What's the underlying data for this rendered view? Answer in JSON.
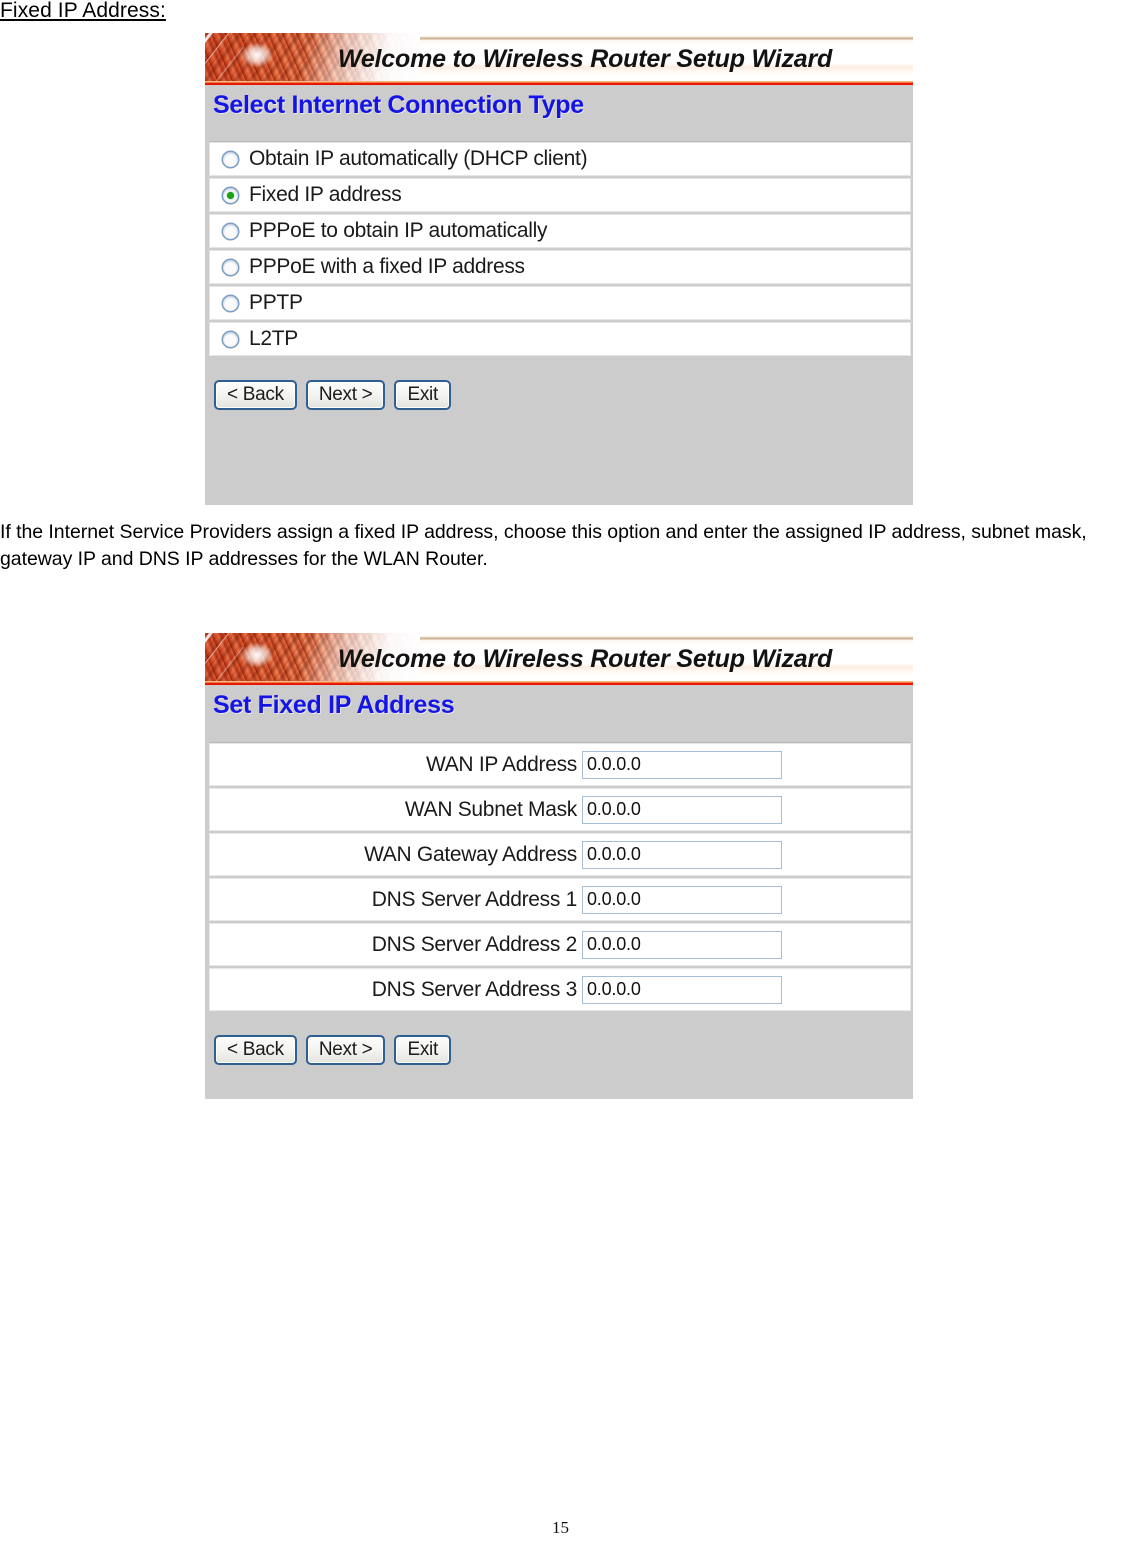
{
  "document": {
    "heading": "Fixed IP Address:",
    "paragraph": "If the Internet Service Providers assign a fixed IP address, choose this option and enter the assigned IP address, subnet mask, gateway IP and DNS IP addresses for the WLAN Router.",
    "page_number": "15"
  },
  "colors": {
    "panel_background": "#cccccc",
    "section_title": "#1414e6",
    "banner_rule": "#ee1b05",
    "radio_selected": "#17a317",
    "button_border": "#2f5f91",
    "input_border": "#a7bdd6"
  },
  "panel1": {
    "banner_title": "Welcome to Wireless Router Setup Wizard",
    "section_title": "Select Internet Connection Type",
    "options": [
      {
        "label": "Obtain IP automatically (DHCP client)",
        "selected": false
      },
      {
        "label": "Fixed IP address",
        "selected": true
      },
      {
        "label": "PPPoE to obtain IP automatically",
        "selected": false
      },
      {
        "label": "PPPoE with a fixed IP address",
        "selected": false
      },
      {
        "label": "PPTP",
        "selected": false
      },
      {
        "label": "L2TP",
        "selected": false
      }
    ],
    "buttons": {
      "back": "< Back",
      "next": "Next >",
      "exit": "Exit"
    }
  },
  "panel2": {
    "banner_title": "Welcome to Wireless Router Setup Wizard",
    "section_title": "Set Fixed IP Address",
    "fields": [
      {
        "label": "WAN IP Address",
        "value": "0.0.0.0"
      },
      {
        "label": "WAN Subnet Mask",
        "value": "0.0.0.0"
      },
      {
        "label": "WAN Gateway Address",
        "value": "0.0.0.0"
      },
      {
        "label": "DNS Server Address 1",
        "value": "0.0.0.0"
      },
      {
        "label": "DNS Server Address 2",
        "value": "0.0.0.0"
      },
      {
        "label": "DNS Server Address 3",
        "value": "0.0.0.0"
      }
    ],
    "buttons": {
      "back": "< Back",
      "next": "Next >",
      "exit": "Exit"
    }
  }
}
